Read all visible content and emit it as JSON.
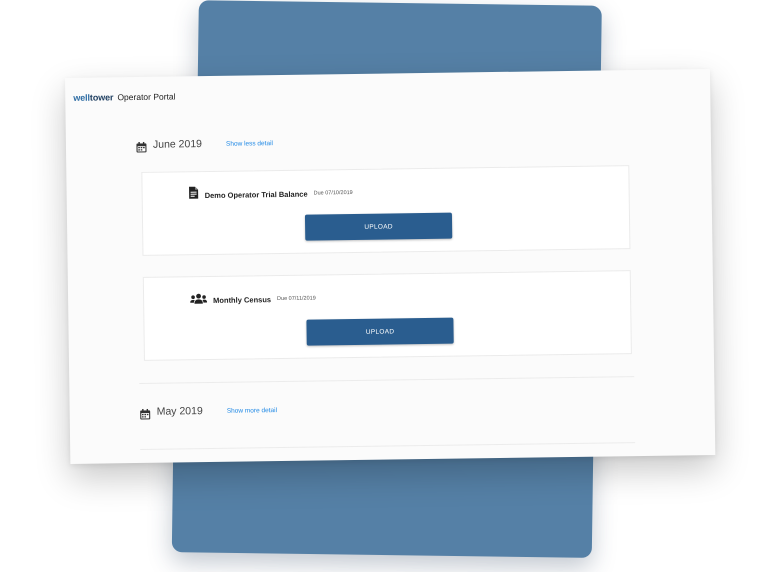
{
  "app": {
    "logo_prefix": "well",
    "logo_suffix": "tower",
    "portal_title": "Operator Portal"
  },
  "months": [
    {
      "label": "June 2019",
      "detail_link": "Show less detail",
      "tasks": [
        {
          "title": "Demo Operator Trial Balance",
          "due": "Due 07/10/2019",
          "icon": "document-icon",
          "button": "UPLOAD"
        },
        {
          "title": "Monthly Census",
          "due": "Due 07/11/2019",
          "icon": "people-icon",
          "button": "UPLOAD"
        }
      ]
    },
    {
      "label": "May 2019",
      "detail_link": "Show more detail"
    }
  ],
  "colors": {
    "backdrop": "#5580a6",
    "button": "#2a5d8f",
    "link": "#1e88e5",
    "logo": "#2e6da4"
  }
}
